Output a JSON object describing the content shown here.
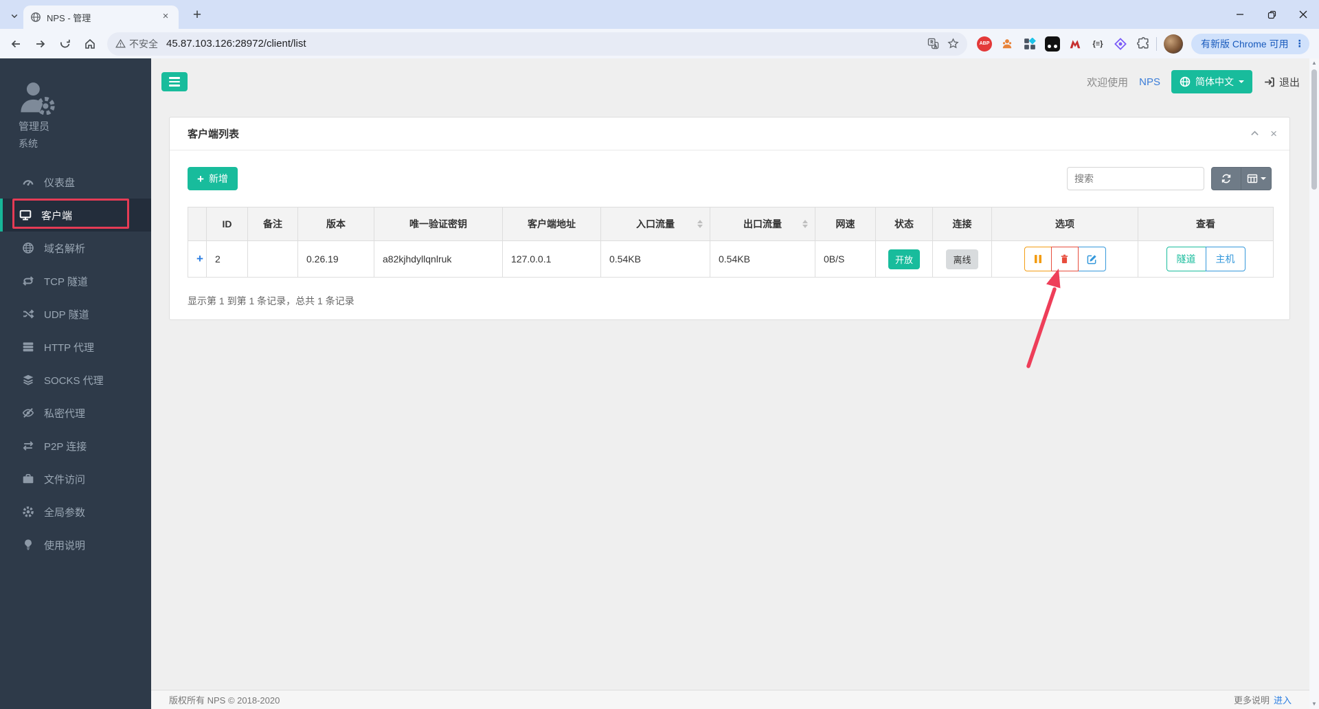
{
  "browser": {
    "tab_title": "NPS - 管理",
    "security_label": "不安全",
    "url": "45.87.103.126:28972/client/list",
    "update_button": "有新版 Chrome 可用",
    "brace_ext": "{≡}"
  },
  "app_header": {
    "welcome": "欢迎使用",
    "brand": "NPS",
    "language": "简体中文",
    "logout": "退出"
  },
  "sidebar": {
    "role": "管理员",
    "system": "系统",
    "items": [
      {
        "label": "仪表盘"
      },
      {
        "label": "客户端"
      },
      {
        "label": "域名解析"
      },
      {
        "label": "TCP 隧道"
      },
      {
        "label": "UDP 隧道"
      },
      {
        "label": "HTTP 代理"
      },
      {
        "label": "SOCKS 代理"
      },
      {
        "label": "私密代理"
      },
      {
        "label": "P2P 连接"
      },
      {
        "label": "文件访问"
      },
      {
        "label": "全局参数"
      },
      {
        "label": "使用说明"
      }
    ]
  },
  "panel": {
    "title": "客户端列表",
    "add_button": "新增",
    "search_placeholder": "搜索",
    "summary": "显示第 1 到第 1 条记录，总共 1 条记录"
  },
  "table": {
    "columns": [
      "",
      "ID",
      "备注",
      "版本",
      "唯一验证密钥",
      "客户端地址",
      "入口流量",
      "出口流量",
      "网速",
      "状态",
      "连接",
      "选项",
      "查看"
    ],
    "row": {
      "expand": "+",
      "id": "2",
      "remark": "",
      "version": "0.26.19",
      "vkey": "a82kjhdyllqnlruk",
      "address": "127.0.0.1",
      "traffic_in": "0.54KB",
      "traffic_out": "0.54KB",
      "speed": "0B/S",
      "status": "开放",
      "connection": "离线",
      "view_tunnel": "隧道",
      "view_host": "主机"
    }
  },
  "footer": {
    "copyright": "版权所有 NPS © 2018-2020",
    "more": "更多说明",
    "enter": "进入"
  },
  "colors": {
    "accent_green": "#18bc9c",
    "blue": "#3498db",
    "orange": "#f39c12",
    "red": "#e74c3c",
    "link_blue": "#3b7dd8",
    "annotation_red": "#e63b55",
    "sidebar_bg": "#2e3a49"
  }
}
